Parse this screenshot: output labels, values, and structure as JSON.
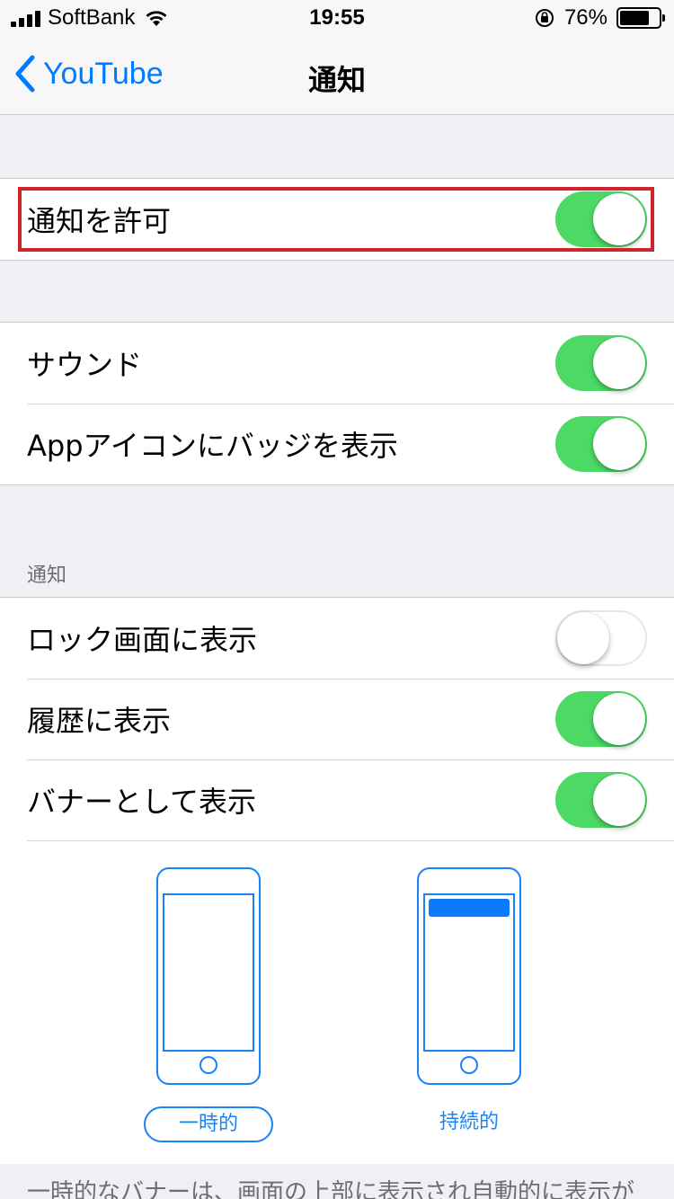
{
  "status_bar": {
    "carrier": "SoftBank",
    "time": "19:55",
    "battery_percent": "76%",
    "battery_level": 0.76
  },
  "nav": {
    "back_label": "YouTube",
    "title": "通知"
  },
  "allow_notifications": {
    "label": "通知を許可",
    "on": true
  },
  "group2": [
    {
      "label": "サウンド",
      "on": true
    },
    {
      "label": "Appアイコンにバッジを表示",
      "on": true
    }
  ],
  "section_header": "通知",
  "group3": [
    {
      "label": "ロック画面に表示",
      "on": false
    },
    {
      "label": "履歴に表示",
      "on": true
    },
    {
      "label": "バナーとして表示",
      "on": true
    }
  ],
  "banner_styles": [
    {
      "label": "一時的",
      "selected": true
    },
    {
      "label": "持続的",
      "selected": false
    }
  ],
  "footer": "一時的なバナーは、画面の上部に表示され自動的に表示が",
  "colors": {
    "accent": "#007aff",
    "toggle_on": "#4cd964",
    "highlight": "#d0232b"
  }
}
